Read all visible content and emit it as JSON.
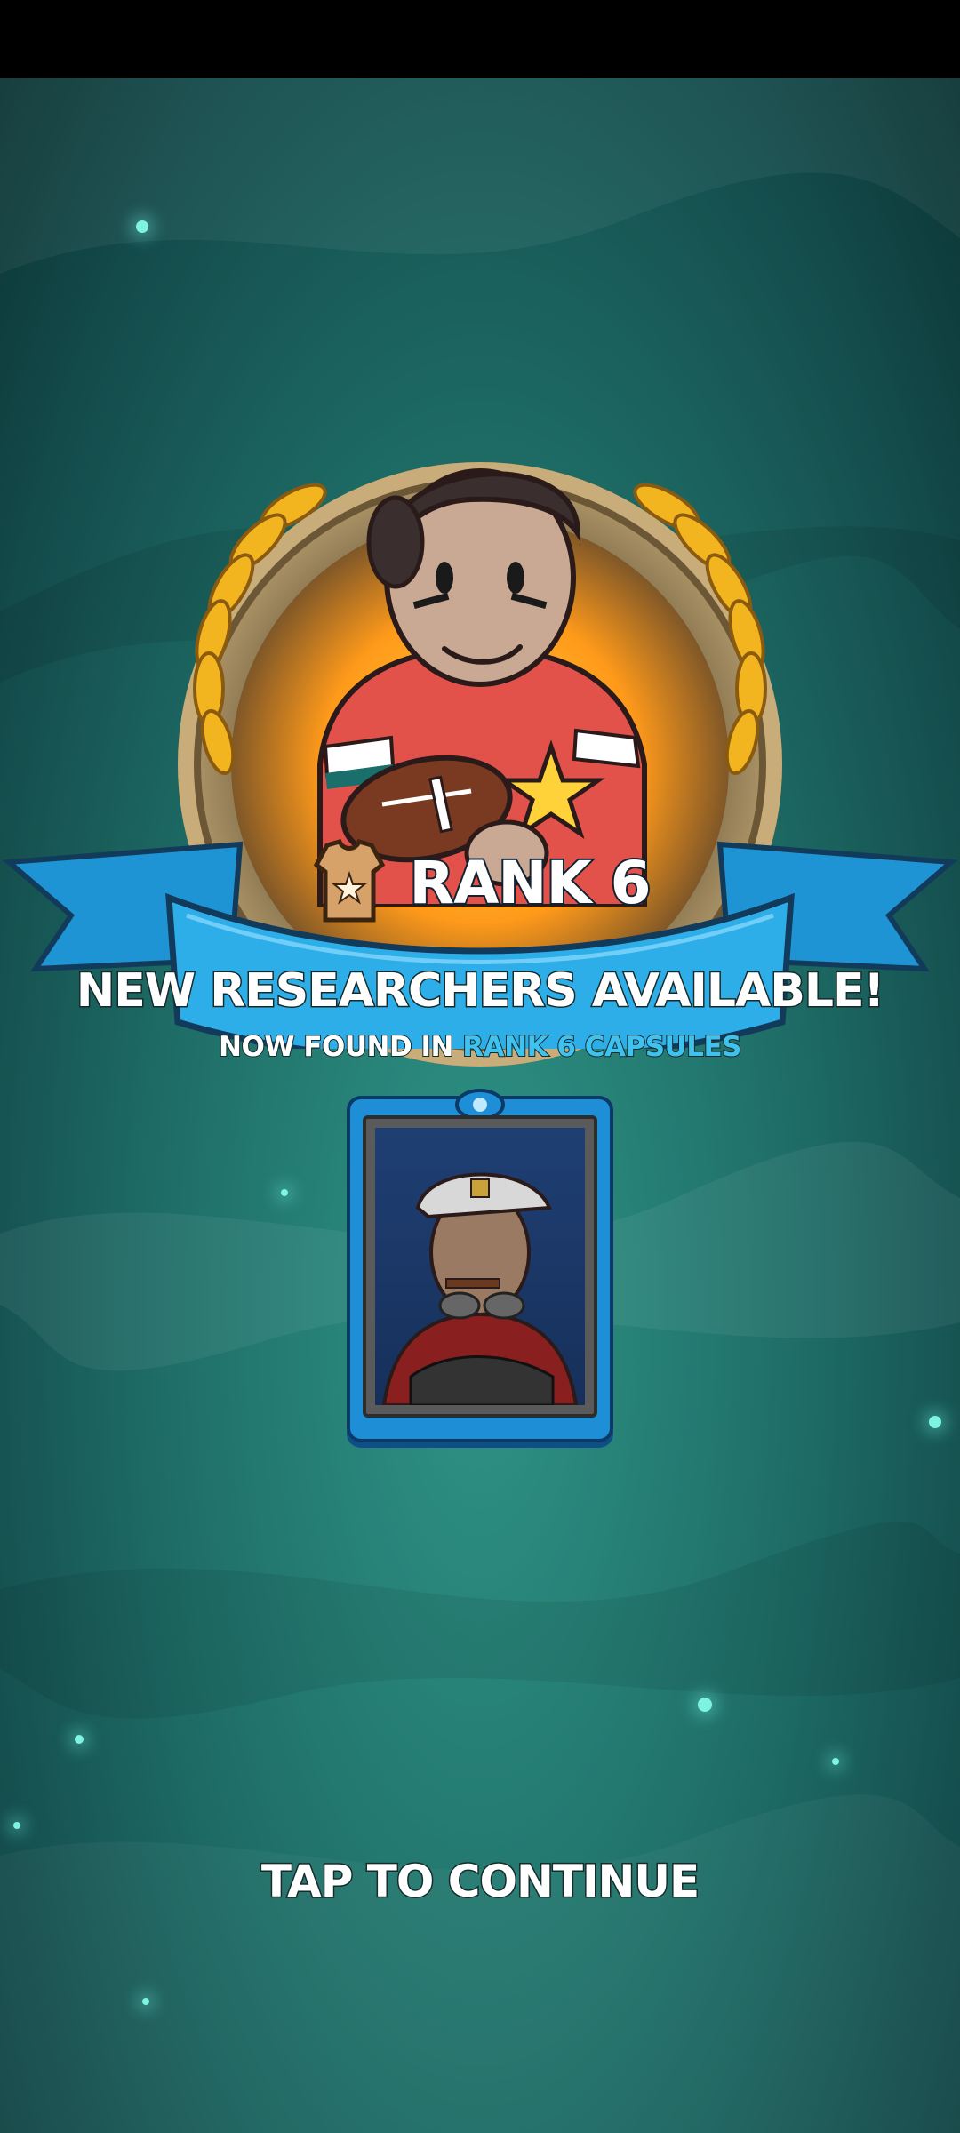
{
  "rank_banner": {
    "title": "RANK 6",
    "icon": "jersey-icon"
  },
  "message": {
    "headline": "NEW RESEARCHERS AVAILABLE!",
    "sub_prefix": "NOW FOUND IN",
    "sub_highlight": "RANK 6 CAPSULES"
  },
  "researcher_card": {
    "portrait": "researcher-portrait",
    "emblem": "card-emblem-icon"
  },
  "footer": {
    "tap_label": "TAP TO CONTINUE"
  },
  "colors": {
    "background": "#1f6f68",
    "ribbon": "#2eaee8",
    "highlight": "#3fc2f0",
    "card": "#1e8ed6"
  }
}
